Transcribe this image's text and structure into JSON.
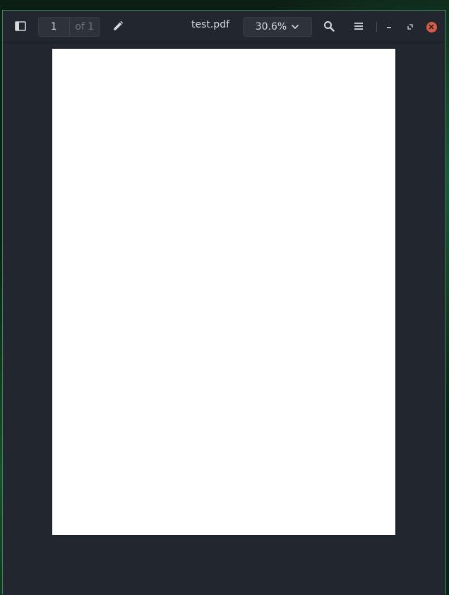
{
  "window": {
    "document_title": "test.pdf"
  },
  "toolbar": {
    "sidebar_toggle_icon": "sidebar-icon",
    "page_current": "1",
    "page_total": "of 1",
    "edit_icon": "pencil-icon",
    "zoom_level": "30.6%",
    "zoom_icon": "chevron-down-icon",
    "search_icon": "search-icon",
    "menu_icon": "hamburger-menu-icon"
  },
  "window_controls": {
    "minimize_icon": "minimize-icon",
    "maximize_icon": "maximize-icon",
    "close_icon": "close-icon",
    "close_color": "#d95b40"
  },
  "viewer": {
    "page_background": "#ffffff",
    "canvas_background": "#22262e"
  }
}
